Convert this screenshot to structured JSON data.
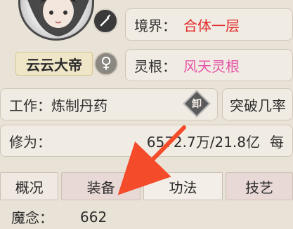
{
  "profile": {
    "name": "云云大帝",
    "gender_symbol": "♀",
    "icons": {
      "avatar": "avatar",
      "edit": "brush-icon",
      "gender": "female-icon"
    }
  },
  "stats": {
    "realm_label": "境界：",
    "realm_value": "合体一层",
    "spiritual_root_label": "灵根：",
    "spiritual_root_value": "风天灵根",
    "job_label": "工作：炼制丹药",
    "job_icon_text": "卸",
    "breakthrough_label": "突破几率",
    "cultivation_label": "修为：",
    "cultivation_value": "6572.7万/21.8亿",
    "cultivation_extra": "每"
  },
  "tabs": [
    {
      "label": "概况"
    },
    {
      "label": "装备"
    },
    {
      "label": "功法"
    },
    {
      "label": "技艺"
    }
  ],
  "bottom": {
    "label": "魔念：",
    "value": "662"
  },
  "colors": {
    "red": "#e02a2a",
    "pink": "#e654a8",
    "arrow": "#f44b2a"
  }
}
